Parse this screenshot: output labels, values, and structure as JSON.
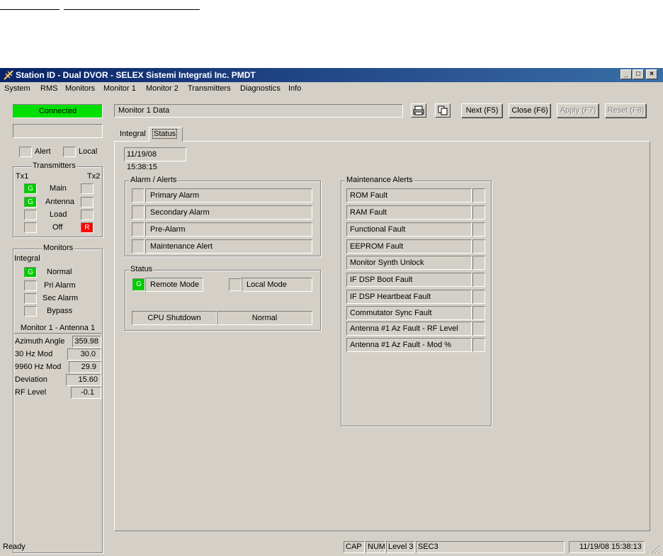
{
  "window": {
    "title": "Station ID - Dual DVOR - SELEX Sistemi Integrati Inc. PMDT"
  },
  "menu": [
    "System",
    "RMS",
    "Monitors",
    "Monitor 1",
    "Monitor 2",
    "Transmitters",
    "Diagnostics",
    "Info"
  ],
  "left": {
    "connection": "Connected",
    "alert_label": "Alert",
    "local_label": "Local",
    "transmitters": {
      "title": "Transmitters",
      "tx1": "Tx1",
      "tx2": "Tx2",
      "rows": [
        {
          "label": "Main",
          "left": "G",
          "right": ""
        },
        {
          "label": "Antenna",
          "left": "G",
          "right": ""
        },
        {
          "label": "Load",
          "left": "",
          "right": ""
        },
        {
          "label": "Off",
          "left": "",
          "right": "R"
        }
      ]
    },
    "monitors": {
      "title": "Monitors",
      "integral": "Integral",
      "rows": [
        {
          "label": "Normal",
          "state": "G"
        },
        {
          "label": "Pri Alarm",
          "state": ""
        },
        {
          "label": "Sec Alarm",
          "state": ""
        },
        {
          "label": "Bypass",
          "state": ""
        }
      ],
      "antenna_header": "Monitor 1 - Antenna 1",
      "params": [
        {
          "name": "Azimuth Angle",
          "value": "359.98"
        },
        {
          "name": "30 Hz Mod",
          "value": "30.0"
        },
        {
          "name": "9960 Hz Mod",
          "value": "29.9"
        },
        {
          "name": "Deviation",
          "value": "15.60"
        },
        {
          "name": "RF Level",
          "value": "-0.1"
        }
      ]
    }
  },
  "toolbar": {
    "panel_title": "Monitor 1 Data",
    "next": "Next (F5)",
    "close": "Close (F6)",
    "apply": "Apply (F7)",
    "reset": "Reset (F8)"
  },
  "tabs": [
    "Integral",
    "Status"
  ],
  "content": {
    "timestamp": "11/19/08 15:38:15",
    "alarm_alerts": {
      "title": "Alarm / Alerts",
      "items": [
        "Primary Alarm",
        "Secondary Alarm",
        "Pre-Alarm",
        "Maintenance Alert"
      ]
    },
    "status": {
      "title": "Status",
      "remote_mode": "Remote Mode",
      "remote_state": "G",
      "local_mode": "Local Mode",
      "cpu_label": "CPU Shutdown",
      "cpu_value": "Normal"
    },
    "maintenance": {
      "title": "Maintenance Alerts",
      "items": [
        "ROM Fault",
        "RAM Fault",
        "Functional Fault",
        "EEPROM Fault",
        "Monitor Synth Unlock",
        "IF DSP Boot Fault",
        "IF DSP Heartbeat Fault",
        "Commutator Sync Fault",
        "Antenna #1 Az Fault - RF Level",
        "Antenna #1 Az Fault - Mod %"
      ]
    }
  },
  "statusbar": {
    "ready": "Ready",
    "cap": "CAP",
    "num": "NUM",
    "level": "Level 3",
    "sec": "SEC3",
    "datetime": "11/19/08 15:38:13"
  },
  "colors": {
    "green": "#00cc00",
    "red": "#ff0000",
    "title_start": "#0a246a",
    "title_end": "#3a6ea5",
    "face": "#d4d0c8"
  }
}
